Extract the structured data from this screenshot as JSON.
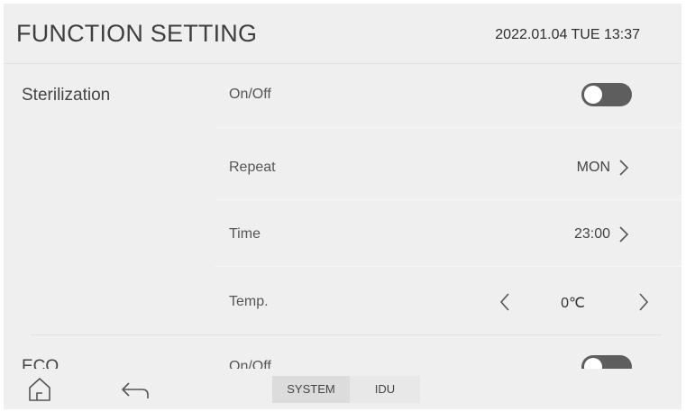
{
  "header": {
    "title": "FUNCTION SETTING",
    "datetime": "2022.01.04 TUE 13:37"
  },
  "sterilization": {
    "label": "Sterilization",
    "onoff": {
      "label": "On/Off",
      "state": "off"
    },
    "repeat": {
      "label": "Repeat",
      "value": "MON",
      "icon": "chevron-right-icon"
    },
    "time": {
      "label": "Time",
      "value": "23:00",
      "icon": "chevron-right-icon"
    },
    "temp": {
      "label": "Temp.",
      "value": "0℃",
      "left_icon": "chevron-left-icon",
      "right_icon": "chevron-right-icon"
    }
  },
  "eco": {
    "label": "ECO",
    "onoff": {
      "label": "On/Off",
      "state": "off"
    }
  },
  "footer": {
    "home_icon": "home-icon",
    "back_icon": "back-arrow-icon",
    "tabs": [
      {
        "label": "SYSTEM",
        "selected": true
      },
      {
        "label": "IDU",
        "selected": false
      }
    ]
  },
  "colors": {
    "background": "#efefef",
    "toggle_off": "#5e5e5e",
    "text": "#444444",
    "tab_selected": "#dcdcdc",
    "tab_unselected": "#e8e8e8"
  }
}
